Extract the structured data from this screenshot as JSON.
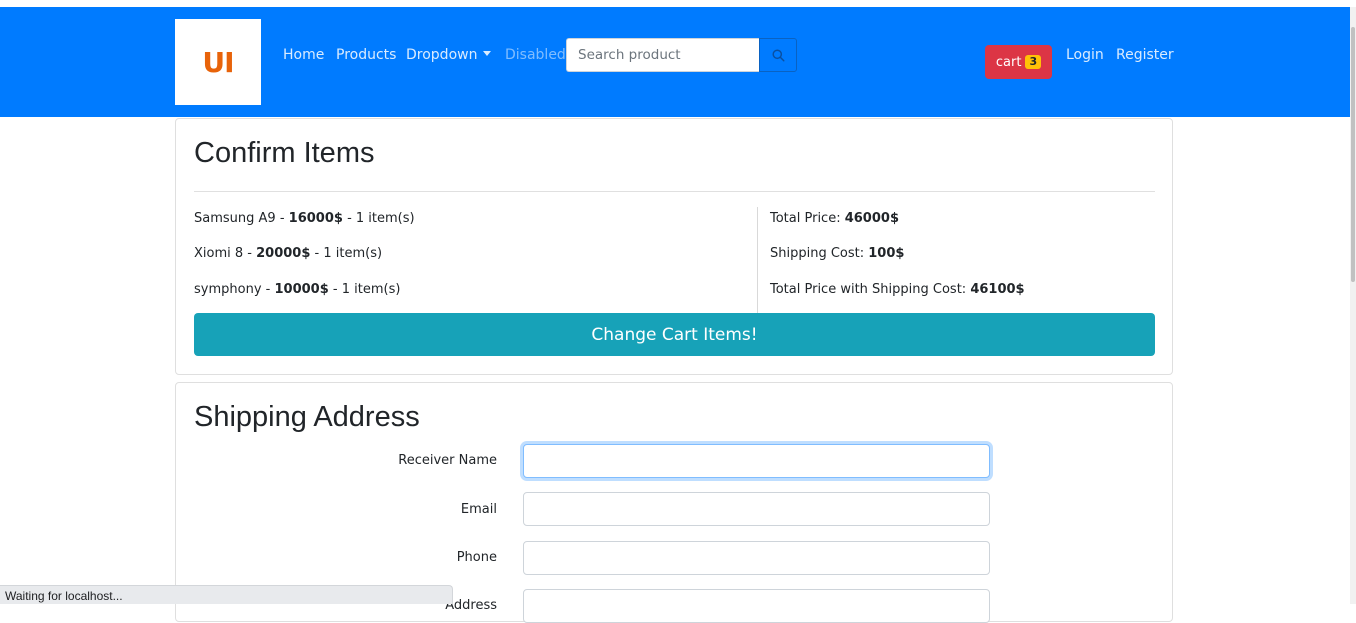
{
  "navbar": {
    "logo_text": "UI",
    "links": [
      "Home",
      "Products",
      "Dropdown",
      "Disabled"
    ],
    "search": {
      "placeholder": "Search product",
      "value": ""
    },
    "cart": {
      "label": "cart",
      "count": "3"
    },
    "login": "Login",
    "register": "Register"
  },
  "confirm": {
    "title": "Confirm Items",
    "items": [
      {
        "name": "Samsung A9",
        "price": "16000$",
        "qty": "1 item(s)"
      },
      {
        "name": "Xiomi 8",
        "price": "20000$",
        "qty": "1 item(s)"
      },
      {
        "name": "symphony",
        "price": "10000$",
        "qty": "1 item(s)"
      }
    ],
    "separator": " - ",
    "totals": [
      {
        "label": "Total Price: ",
        "value": "46000$"
      },
      {
        "label": "Shipping Cost: ",
        "value": "100$"
      },
      {
        "label": "Total Price with Shipping Cost: ",
        "value": "46100$"
      }
    ],
    "change_button": "Change Cart Items!"
  },
  "shipping": {
    "title": "Shipping Address",
    "fields": [
      {
        "label": "Receiver Name",
        "value": ""
      },
      {
        "label": "Email",
        "value": ""
      },
      {
        "label": "Phone",
        "value": ""
      },
      {
        "label": "Address",
        "value": ""
      }
    ]
  },
  "status_bar": "Waiting for localhost...",
  "colors": {
    "navbar": "#007bff",
    "cart": "#dc3545",
    "badge": "#ffc107",
    "change_button": "#17a2b8",
    "logo_text": "#e8630a"
  }
}
